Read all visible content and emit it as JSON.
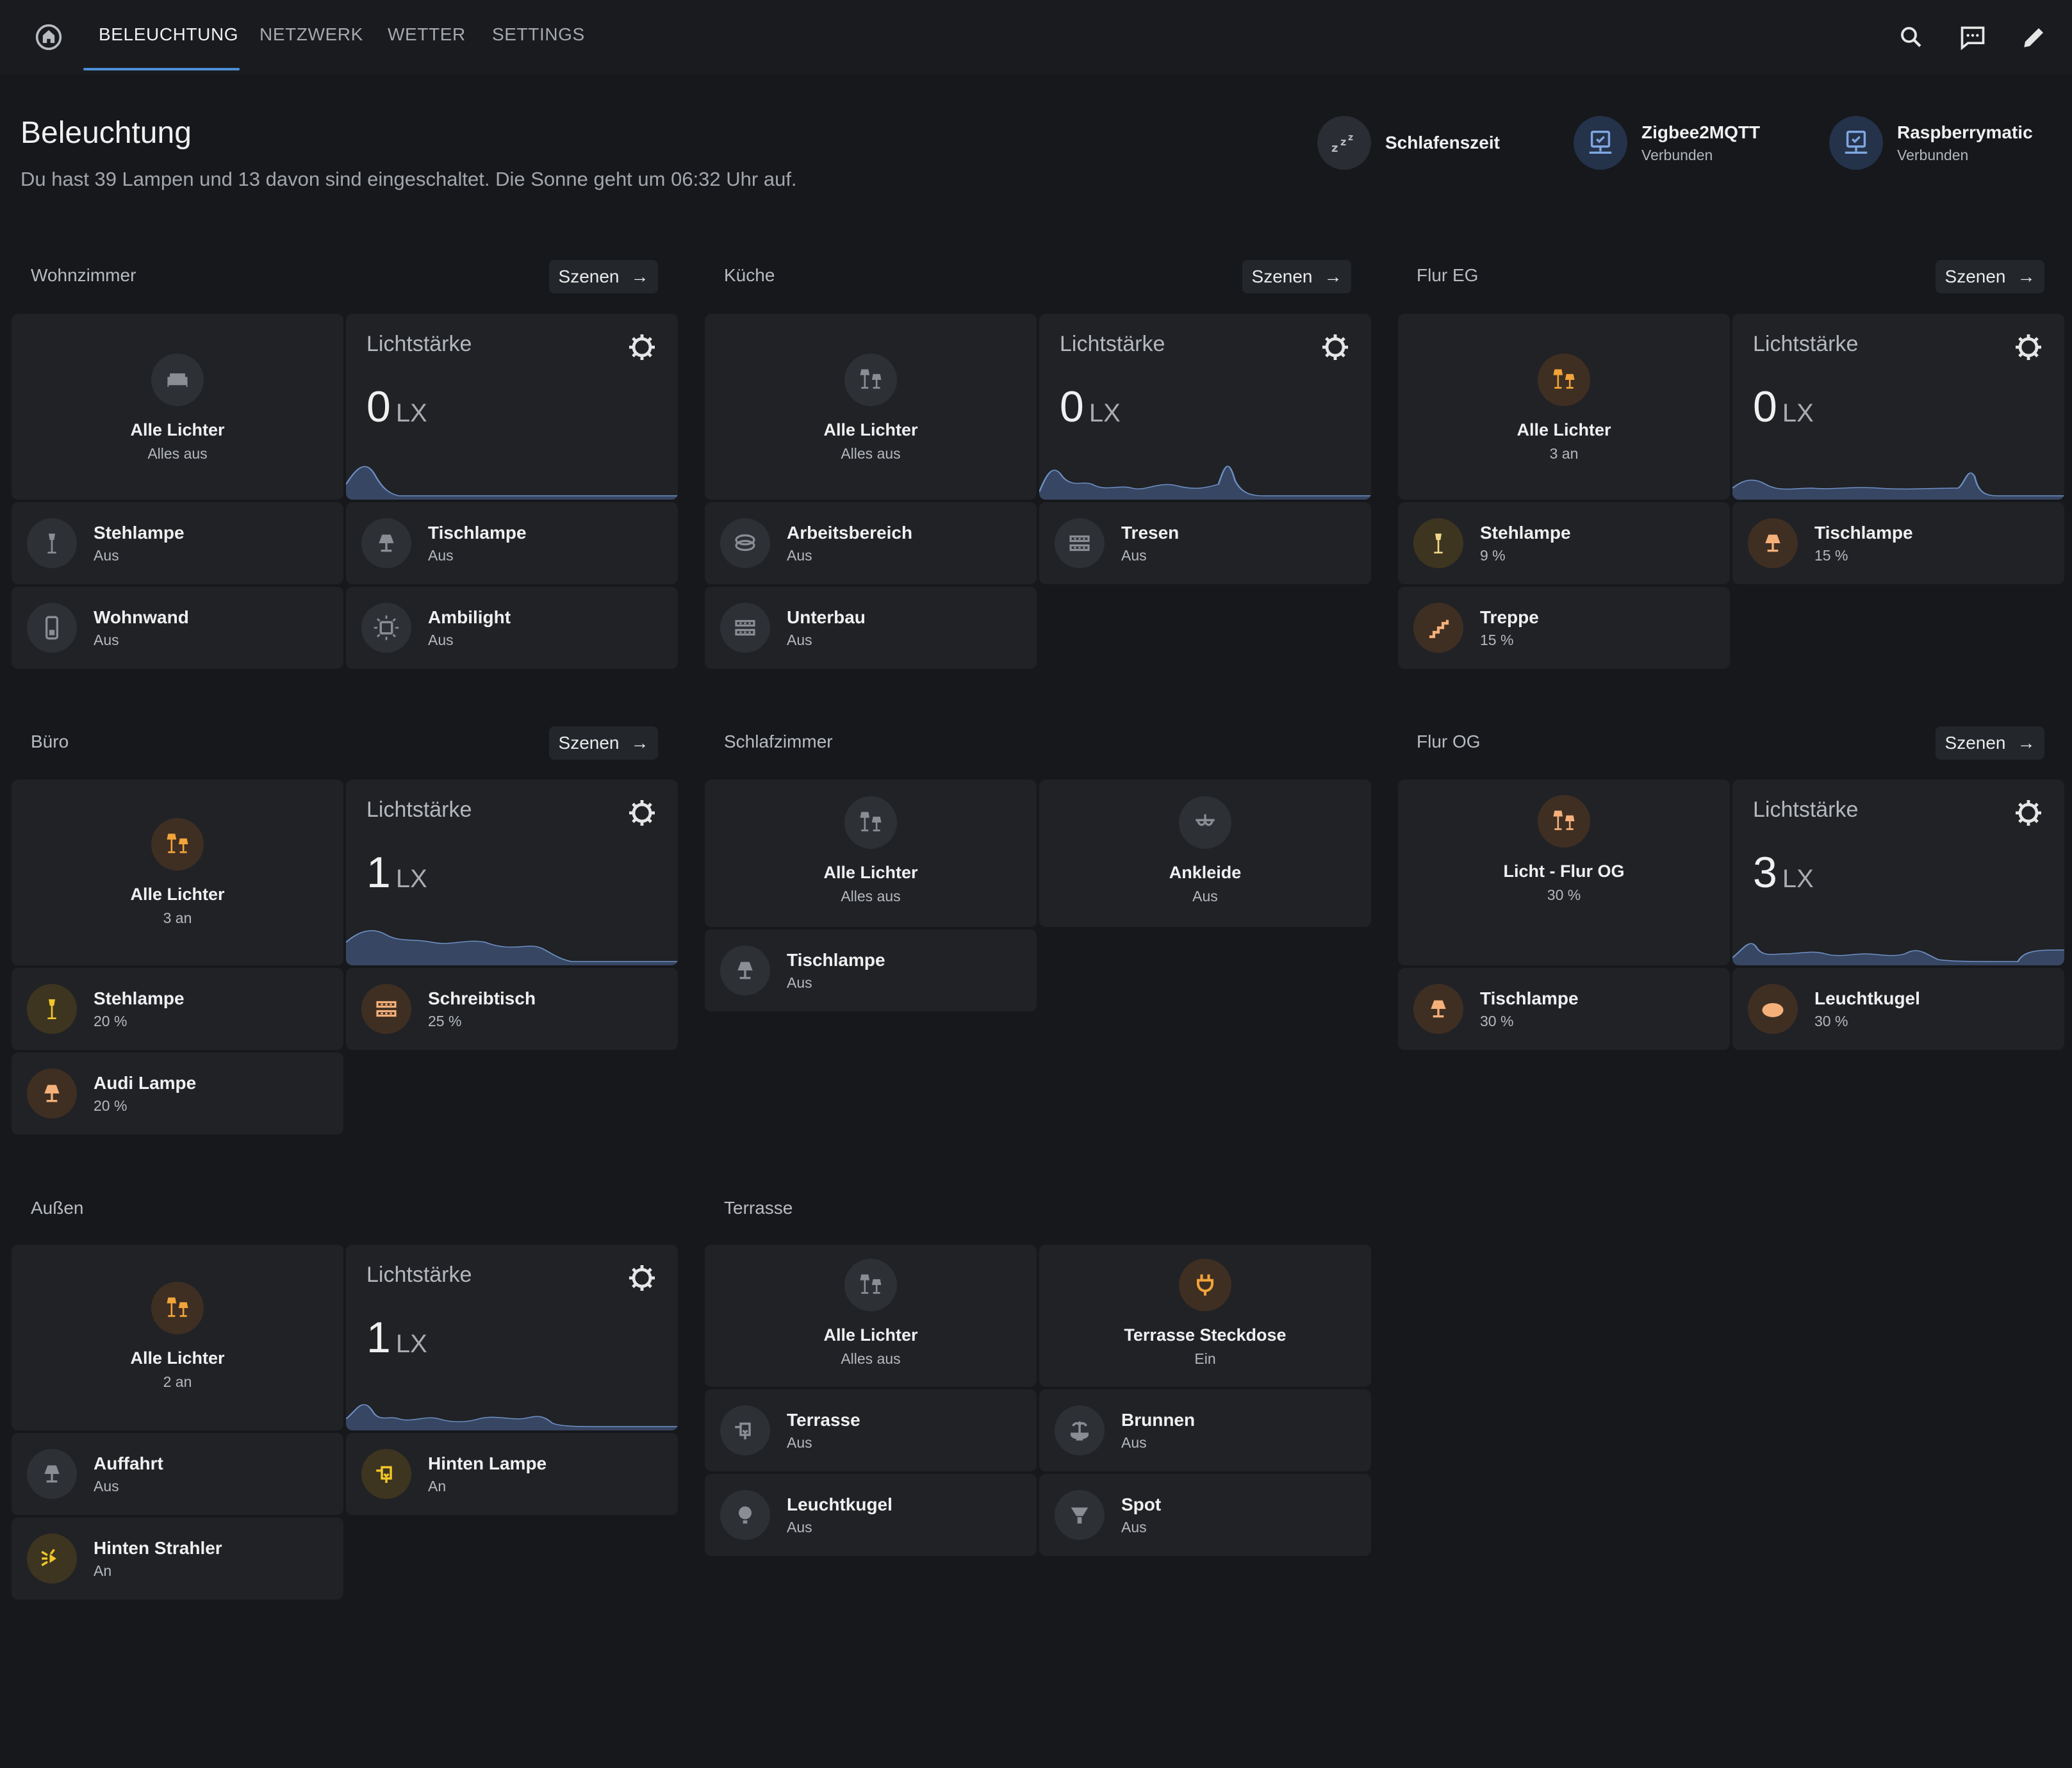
{
  "topbar": {
    "tabs": [
      "BELEUCHTUNG",
      "NETZWERK",
      "WETTER",
      "SETTINGS"
    ],
    "active_tab": "BELEUCHTUNG",
    "accent": "#4c8fd6",
    "icons": [
      "home-icon",
      "search-icon",
      "message-icon",
      "pencil-icon"
    ]
  },
  "header": {
    "title": "Beleuchtung",
    "subtitle": "Du hast 39 Lampen und 13 davon sind eingeschaltet. Die Sonne geht um 06:32 Uhr auf."
  },
  "chips": [
    {
      "name": "Schlafenszeit",
      "status": "",
      "icon": "sleep-icon"
    },
    {
      "name": "Zigbee2MQTT",
      "status": "Verbunden",
      "icon": "network-monitor-icon"
    },
    {
      "name": "Raspberrymatic",
      "status": "Verbunden",
      "icon": "network-monitor-icon"
    }
  ],
  "scenes_label": "Szenen",
  "sensor_label": "Lichtstärke",
  "unit": "LX",
  "areas": {
    "wohnzimmer": {
      "title": "Wohnzimmer",
      "group": {
        "name": "Alle Lichter",
        "state": "Alles aus",
        "icon": "sofa-icon"
      },
      "lux": "0",
      "lights": [
        {
          "name": "Stehlampe",
          "state": "Aus",
          "icon": "floor-lamp-icon"
        },
        {
          "name": "Tischlampe",
          "state": "Aus",
          "icon": "table-lamp-icon"
        },
        {
          "name": "Wohnwand",
          "state": "Aus",
          "icon": "wall-unit-icon"
        },
        {
          "name": "Ambilight",
          "state": "Aus",
          "icon": "ambilight-icon"
        }
      ]
    },
    "kueche": {
      "title": "Küche",
      "group": {
        "name": "Alle Lichter",
        "state": "Alles aus",
        "icon": "lamps-icon"
      },
      "lux": "0",
      "lights": [
        {
          "name": "Arbeitsbereich",
          "state": "Aus",
          "icon": "led-strip-icon"
        },
        {
          "name": "Tresen",
          "state": "Aus",
          "icon": "led-strip-icon"
        },
        {
          "name": "Unterbau",
          "state": "Aus",
          "icon": "led-strip-icon"
        }
      ]
    },
    "flur_eg": {
      "title": "Flur EG",
      "group": {
        "name": "Alle Lichter",
        "state": "3 an",
        "icon": "lamps-icon"
      },
      "lux": "0",
      "lights": [
        {
          "name": "Stehlampe",
          "state": "9 %",
          "icon": "floor-lamp-icon"
        },
        {
          "name": "Tischlampe",
          "state": "15 %",
          "icon": "table-lamp-icon"
        },
        {
          "name": "Treppe",
          "state": "15 %",
          "icon": "stairs-icon"
        }
      ]
    },
    "buero": {
      "title": "Büro",
      "group": {
        "name": "Alle Lichter",
        "state": "3 an",
        "icon": "lamps-icon"
      },
      "lux": "1",
      "lights": [
        {
          "name": "Stehlampe",
          "state": "20 %",
          "icon": "floor-lamp-icon"
        },
        {
          "name": "Schreibtisch",
          "state": "25 %",
          "icon": "led-strip-icon"
        },
        {
          "name": "Audi Lampe",
          "state": "20 %",
          "icon": "table-lamp-icon"
        }
      ]
    },
    "schlafzimmer": {
      "title": "Schlafzimmer",
      "group": {
        "name": "Alle Lichter",
        "state": "Alles aus",
        "icon": "lamps-icon"
      },
      "extra": {
        "name": "Ankleide",
        "state": "Aus",
        "icon": "ceiling-light-icon"
      },
      "lights": [
        {
          "name": "Tischlampe",
          "state": "Aus",
          "icon": "table-lamp-icon"
        }
      ]
    },
    "flur_og": {
      "title": "Flur OG",
      "group": {
        "name": "Licht - Flur OG",
        "state": "30 %",
        "icon": "lamps-icon"
      },
      "lux": "3",
      "lights": [
        {
          "name": "Tischlampe",
          "state": "30 %",
          "icon": "table-lamp-icon"
        },
        {
          "name": "Leuchtkugel",
          "state": "30 %",
          "icon": "globe-light-icon"
        }
      ]
    },
    "aussen": {
      "title": "Außen",
      "group": {
        "name": "Alle Lichter",
        "state": "2 an",
        "icon": "lamps-icon"
      },
      "lux": "1",
      "lights": [
        {
          "name": "Auffahrt",
          "state": "Aus",
          "icon": "table-lamp-icon"
        },
        {
          "name": "Hinten Lampe",
          "state": "An",
          "icon": "outdoor-lamp-icon"
        },
        {
          "name": "Hinten Strahler",
          "state": "An",
          "icon": "spotlight-beam-icon"
        }
      ]
    },
    "terrasse": {
      "title": "Terrasse",
      "group": {
        "name": "Alle Lichter",
        "state": "Alles aus",
        "icon": "lamps-icon"
      },
      "extra": {
        "name": "Terrasse Steckdose",
        "state": "Ein",
        "icon": "power-plug-icon"
      },
      "lights": [
        {
          "name": "Terrasse",
          "state": "Aus",
          "icon": "outdoor-lamp-icon"
        },
        {
          "name": "Brunnen",
          "state": "Aus",
          "icon": "fountain-icon"
        },
        {
          "name": "Leuchtkugel",
          "state": "Aus",
          "icon": "bulb-icon"
        },
        {
          "name": "Spot",
          "state": "Aus",
          "icon": "spot-icon"
        }
      ]
    }
  }
}
